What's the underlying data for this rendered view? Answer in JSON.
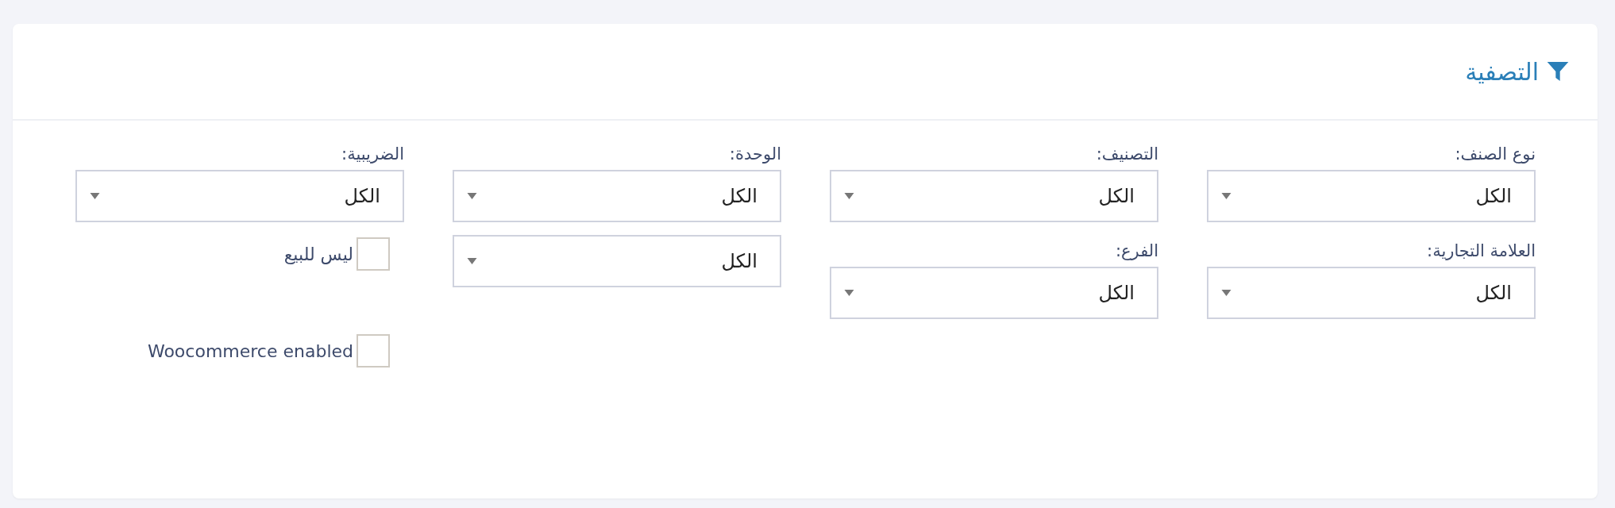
{
  "panel": {
    "title": "التصفية"
  },
  "filters": [
    {
      "kind": "select",
      "label": "نوع الصنف:",
      "value": "الكل"
    },
    {
      "kind": "select",
      "label": "التصنيف:",
      "value": "الكل"
    },
    {
      "kind": "select",
      "label": "الوحدة:",
      "value": "الكل"
    },
    {
      "kind": "select",
      "label": "الضريبية:",
      "value": "الكل"
    },
    {
      "kind": "select",
      "label": "العلامة التجارية:",
      "value": "الكل"
    },
    {
      "kind": "select",
      "label": "الفرع:",
      "value": "الكل"
    },
    {
      "kind": "select",
      "value": "الكل"
    },
    {
      "kind": "checkbox",
      "label": "ليس للبيع",
      "checked": false
    },
    {
      "kind": "spacer"
    },
    {
      "kind": "spacer"
    },
    {
      "kind": "spacer"
    },
    {
      "kind": "checkbox",
      "label": "Woocommerce enabled",
      "checked": false
    }
  ]
}
